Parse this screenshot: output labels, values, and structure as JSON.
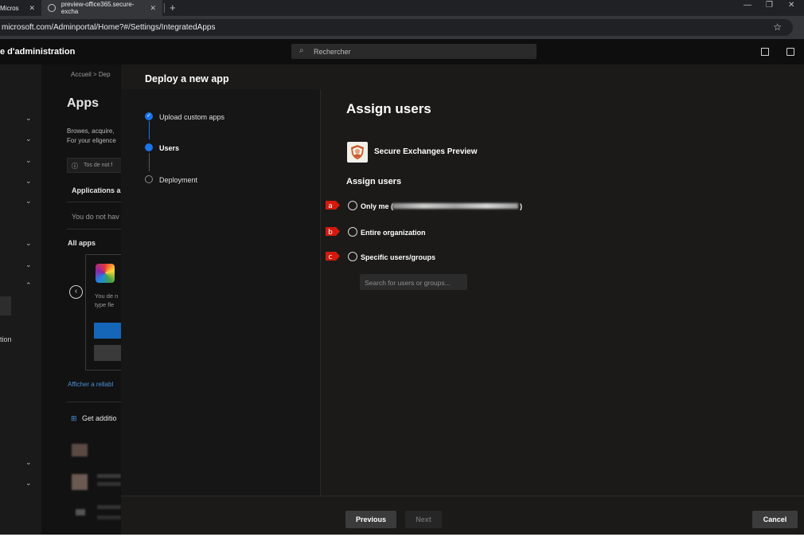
{
  "browser": {
    "tabs": [
      {
        "label": "Micros"
      },
      {
        "label": "preview-office365.secure-excha"
      }
    ],
    "new_tab_label": "+",
    "url": "microsoft.com/Adminportal/Home?#/Settings/IntegratedApps",
    "window_controls": [
      "—",
      "❐",
      "✕"
    ]
  },
  "app": {
    "title": "e d'administration",
    "search_placeholder": "Rechercher"
  },
  "leftnav": {
    "label_fragment": "tion"
  },
  "background_page": {
    "breadcrumb": "Accueil  >  Dep",
    "title": "Apps",
    "desc_line1": "Browes, acquire,",
    "desc_line2": "For your eligence",
    "info_text": "Tos de not f",
    "tab_label": "Applications a",
    "empty_text": "You do not hav",
    "section_label": "All apps",
    "card_text_1": "You de n",
    "card_text_2": "type fle",
    "link_text": "Afficher a rellabl",
    "get_more": "Get additio"
  },
  "panel": {
    "title": "Deploy a new app",
    "steps": [
      {
        "label": "Upload custom apps",
        "state": "done"
      },
      {
        "label": "Users",
        "state": "current"
      },
      {
        "label": "Deployment",
        "state": "pending"
      }
    ],
    "heading": "Assign users",
    "app_name": "Secure Exchanges Preview",
    "subheading": "Assign users",
    "options": [
      {
        "marker": "a",
        "label": "Only me (",
        "suffix": ")"
      },
      {
        "marker": "b",
        "label": "Entire organization"
      },
      {
        "marker": "c",
        "label": "Specific users/groups"
      }
    ],
    "search_placeholder": "Search for users or groups...",
    "buttons": {
      "previous": "Previous",
      "next": "Next",
      "cancel": "Cancel"
    }
  },
  "colors": {
    "accent": "#1a73e8",
    "marker_red": "#d21a0e"
  }
}
